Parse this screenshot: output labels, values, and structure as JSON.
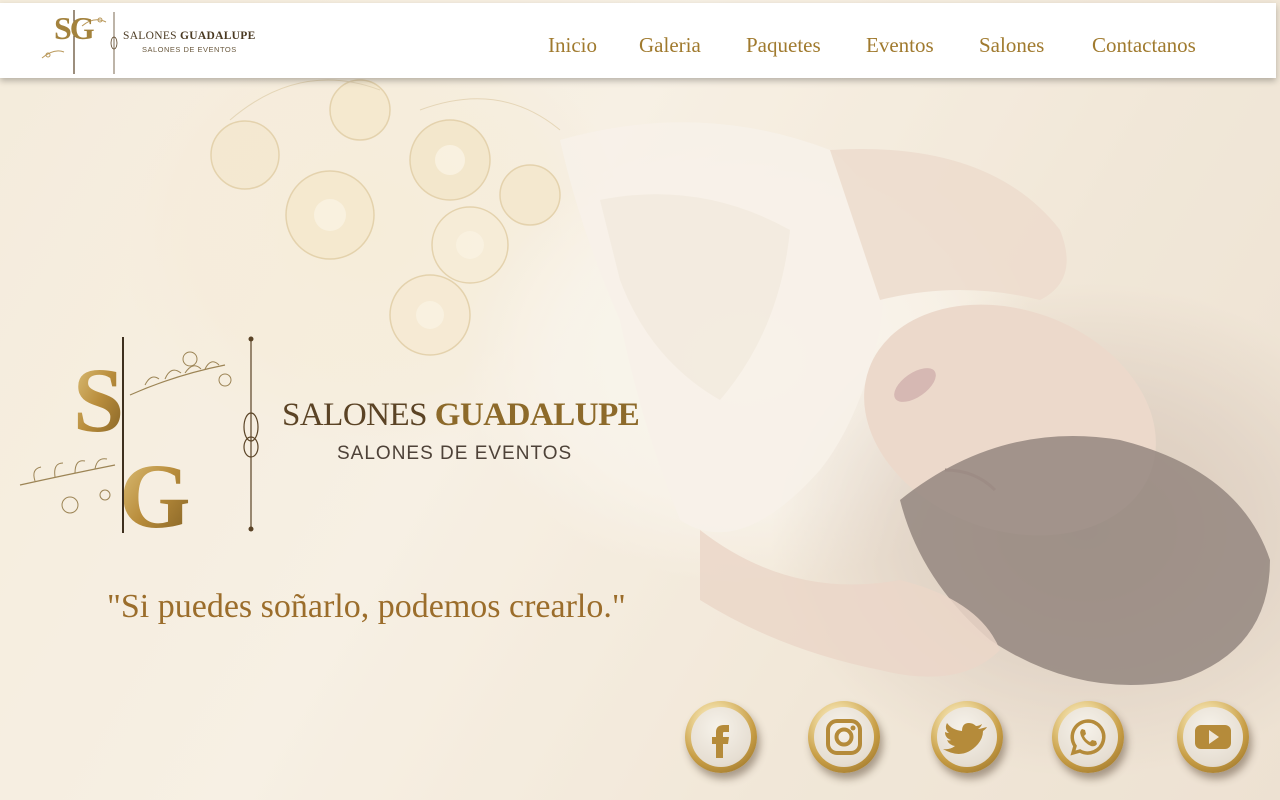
{
  "header": {
    "logo": {
      "monogram": "SG",
      "brand_part1": "SALONES",
      "brand_part2": "GUADALUPE",
      "subtitle": "SALONES DE EVENTOS"
    },
    "nav": [
      {
        "label": "Inicio"
      },
      {
        "label": "Galeria"
      },
      {
        "label": "Paquetes"
      },
      {
        "label": "Eventos"
      },
      {
        "label": "Salones"
      },
      {
        "label": "Contactanos"
      }
    ]
  },
  "hero": {
    "logo": {
      "monogram": "SG",
      "brand_part1": "SALONES",
      "brand_part2": "GUADALUPE",
      "subtitle": "SALONES DE EVENTOS"
    },
    "tagline": "\"Si puedes soñarlo, podemos crearlo.\""
  },
  "social": [
    {
      "name": "facebook-icon"
    },
    {
      "name": "instagram-icon"
    },
    {
      "name": "twitter-icon"
    },
    {
      "name": "whatsapp-icon"
    },
    {
      "name": "youtube-icon"
    }
  ],
  "colors": {
    "gold": "#a07a2e",
    "dark_gold": "#8d6a2a",
    "brown": "#5b4325"
  }
}
